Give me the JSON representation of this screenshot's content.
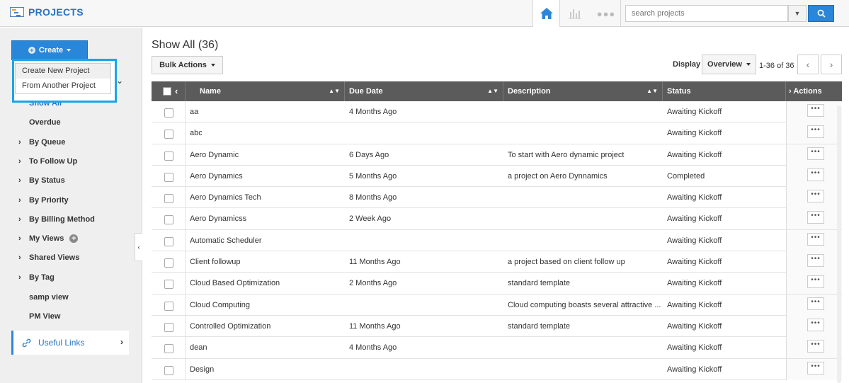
{
  "app": {
    "title": "PROJECTS",
    "icons": {
      "brand": "projects-list-icon",
      "home": "home-icon",
      "chart": "bar-chart-icon",
      "more": "more-dots-icon",
      "search": "search-icon"
    }
  },
  "search": {
    "placeholder": "search projects"
  },
  "colors": {
    "accent": "#2a86d8",
    "header_bg": "#5b5b5b",
    "highlight_border": "#19a6e8"
  },
  "sidebar": {
    "create_label": "Create",
    "create_menu": [
      "Create New Project",
      "From Another Project"
    ],
    "nav": [
      {
        "label": "Show All",
        "expandable": false,
        "active": true
      },
      {
        "label": "Overdue",
        "expandable": false
      },
      {
        "label": "By Queue",
        "expandable": true
      },
      {
        "label": "To Follow Up",
        "expandable": true
      },
      {
        "label": "By Status",
        "expandable": true
      },
      {
        "label": "By Priority",
        "expandable": true
      },
      {
        "label": "By Billing Method",
        "expandable": true
      },
      {
        "label": "My Views",
        "expandable": true,
        "add": true
      },
      {
        "label": "Shared Views",
        "expandable": true
      },
      {
        "label": "By Tag",
        "expandable": true
      },
      {
        "label": "samp view",
        "expandable": false
      },
      {
        "label": "PM View",
        "expandable": false
      }
    ],
    "useful_links": "Useful Links"
  },
  "main": {
    "title": "Show All",
    "count": "(36)",
    "bulk_actions": "Bulk Actions",
    "display_label": "Display",
    "display_value": "Overview",
    "pagination": "1-36 of 36",
    "columns": {
      "name": "Name",
      "due": "Due Date",
      "desc": "Description",
      "status": "Status",
      "actions": "Actions"
    },
    "rows": [
      {
        "name": "aa",
        "due": "4 Months Ago",
        "desc": "",
        "status": "Awaiting Kickoff"
      },
      {
        "name": "abc",
        "due": "",
        "desc": "",
        "status": "Awaiting Kickoff"
      },
      {
        "name": "Aero Dynamic",
        "due": "6 Days Ago",
        "desc": "To start with Aero dynamic project",
        "status": "Awaiting Kickoff"
      },
      {
        "name": "Aero Dynamics",
        "due": "5 Months Ago",
        "desc": "a project on Aero Dynnamics",
        "status": "Completed"
      },
      {
        "name": "Aero Dynamics Tech",
        "due": "8 Months Ago",
        "desc": "",
        "status": "Awaiting Kickoff"
      },
      {
        "name": "Aero Dynamicss",
        "due": "2 Week Ago",
        "desc": "",
        "status": "Awaiting Kickoff"
      },
      {
        "name": "Automatic Scheduler",
        "due": "",
        "desc": "",
        "status": "Awaiting Kickoff"
      },
      {
        "name": "Client followup",
        "due": "11 Months Ago",
        "desc": "a project based on client follow up",
        "status": "Awaiting Kickoff"
      },
      {
        "name": "Cloud Based Optimization",
        "due": "2 Months Ago",
        "desc": "standard template",
        "status": "Awaiting Kickoff"
      },
      {
        "name": "Cloud Computing",
        "due": "",
        "desc": "Cloud computing boasts several attractive ...",
        "status": "Awaiting Kickoff"
      },
      {
        "name": "Controlled Optimization",
        "due": "11 Months Ago",
        "desc": "standard template",
        "status": "Awaiting Kickoff"
      },
      {
        "name": "dean",
        "due": "4 Months Ago",
        "desc": "",
        "status": "Awaiting Kickoff"
      },
      {
        "name": "Design",
        "due": "",
        "desc": "",
        "status": "Awaiting Kickoff"
      }
    ]
  }
}
